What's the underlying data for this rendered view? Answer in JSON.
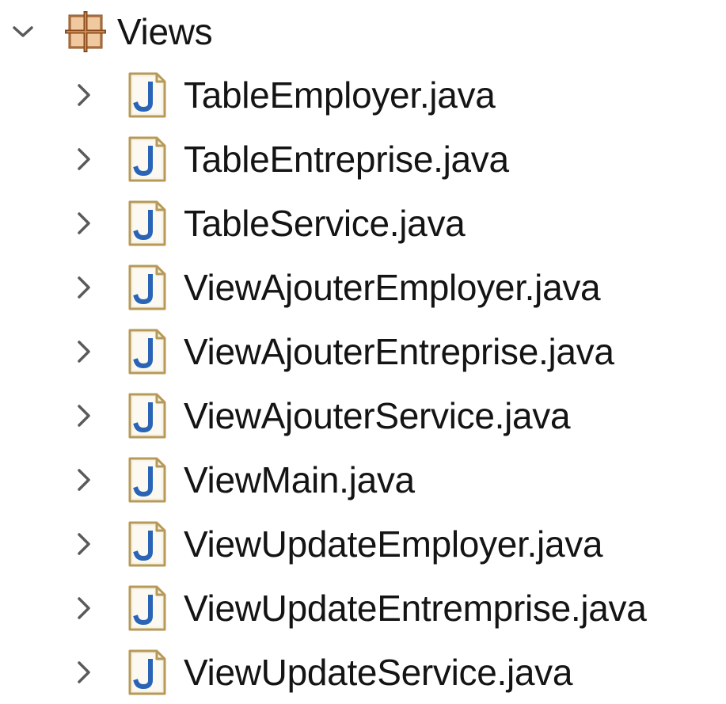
{
  "tree": {
    "package": {
      "label": "Views",
      "expanded": true,
      "chevron_icon": "chevron-down-icon",
      "icon": "package-icon"
    },
    "files": [
      {
        "label": "TableEmployer.java",
        "icon": "java-file-icon",
        "chevron_icon": "chevron-right-icon"
      },
      {
        "label": "TableEntreprise.java",
        "icon": "java-file-icon",
        "chevron_icon": "chevron-right-icon"
      },
      {
        "label": "TableService.java",
        "icon": "java-file-icon",
        "chevron_icon": "chevron-right-icon"
      },
      {
        "label": "ViewAjouterEmployer.java",
        "icon": "java-file-icon",
        "chevron_icon": "chevron-right-icon"
      },
      {
        "label": "ViewAjouterEntreprise.java",
        "icon": "java-file-icon",
        "chevron_icon": "chevron-right-icon"
      },
      {
        "label": "ViewAjouterService.java",
        "icon": "java-file-icon",
        "chevron_icon": "chevron-right-icon"
      },
      {
        "label": "ViewMain.java",
        "icon": "java-file-icon",
        "chevron_icon": "chevron-right-icon"
      },
      {
        "label": "ViewUpdateEmployer.java",
        "icon": "java-file-icon",
        "chevron_icon": "chevron-right-icon"
      },
      {
        "label": "ViewUpdateEntremprise.java",
        "icon": "java-file-icon",
        "chevron_icon": "chevron-right-icon"
      },
      {
        "label": "ViewUpdateService.java",
        "icon": "java-file-icon",
        "chevron_icon": "chevron-right-icon"
      }
    ]
  },
  "colors": {
    "chevron": "#5a5a5a",
    "package_icon_fill": "#c98b4d",
    "package_icon_stroke": "#8a4a1c",
    "java_icon_border": "#b79a58",
    "java_icon_fill": "#f7f3e6",
    "java_letter": "#2a64b7",
    "text": "#141414"
  }
}
